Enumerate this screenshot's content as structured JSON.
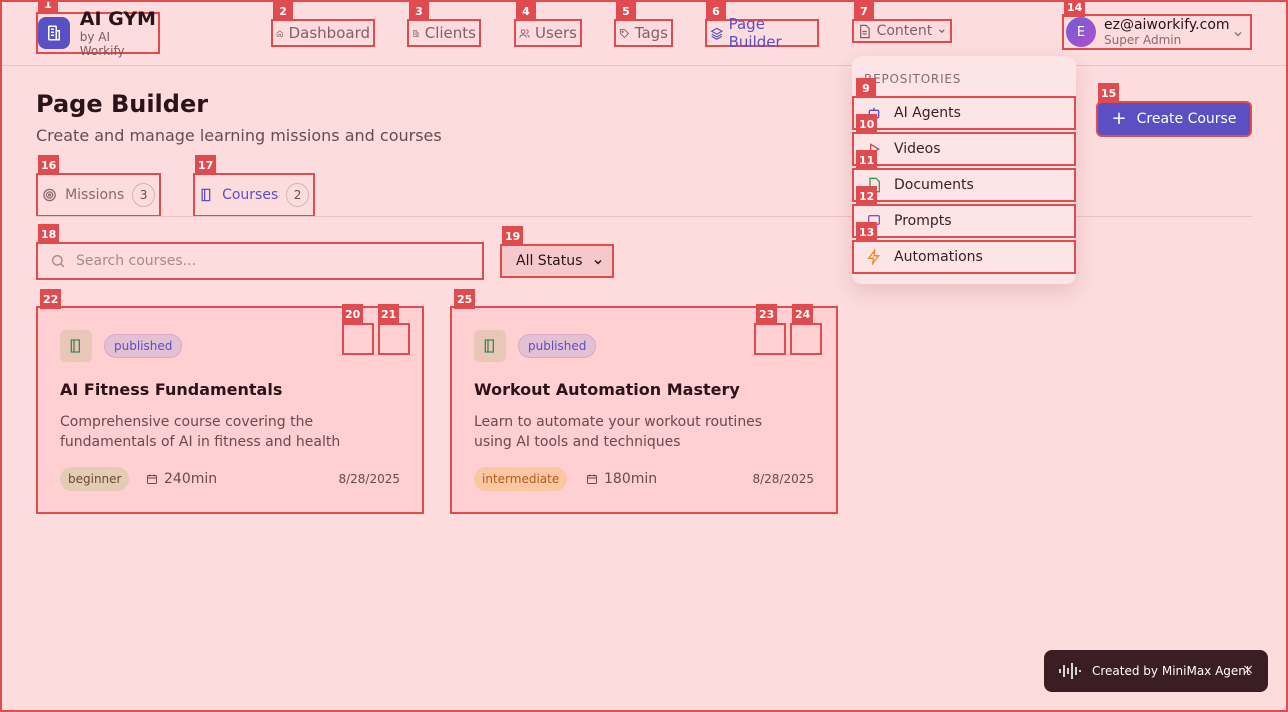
{
  "brand": {
    "title": "AI GYM",
    "subtitle": "by AI Workify"
  },
  "nav": [
    {
      "label": "Dashboard",
      "icon": "home-icon"
    },
    {
      "label": "Clients",
      "icon": "building-icon"
    },
    {
      "label": "Users",
      "icon": "users-icon"
    },
    {
      "label": "Tags",
      "icon": "tag-icon"
    },
    {
      "label": "Page Builder",
      "icon": "layers-icon",
      "active": true
    },
    {
      "label": "Content",
      "icon": "document-icon"
    }
  ],
  "user": {
    "initial": "E",
    "email": "ez@aiworkify.com",
    "role": "Super Admin"
  },
  "content_menu": {
    "heading": "REPOSITORIES",
    "items": [
      {
        "label": "AI Agents",
        "icon": "bot-icon"
      },
      {
        "label": "Videos",
        "icon": "play-icon"
      },
      {
        "label": "Documents",
        "icon": "file-icon"
      },
      {
        "label": "Prompts",
        "icon": "message-icon"
      },
      {
        "label": "Automations",
        "icon": "lightning-icon"
      }
    ]
  },
  "page": {
    "title": "Page Builder",
    "subtitle": "Create and manage learning missions and courses",
    "create_label": "Create Course"
  },
  "tabs": [
    {
      "label": "Missions",
      "count": "3"
    },
    {
      "label": "Courses",
      "count": "2",
      "active": true
    }
  ],
  "filters": {
    "search_placeholder": "Search courses...",
    "status": "All Status"
  },
  "courses": [
    {
      "status": "published",
      "title": "AI Fitness Fundamentals",
      "description": "Comprehensive course covering the fundamentals of AI in fitness and health",
      "level": "beginner",
      "duration": "240min",
      "date": "8/28/2025"
    },
    {
      "status": "published",
      "title": "Workout Automation Mastery",
      "description": "Learn to automate your workout routines using AI tools and techniques",
      "level": "intermediate",
      "duration": "180min",
      "date": "8/28/2025"
    }
  ],
  "toast": {
    "text": "Created by MiniMax Agent",
    "close": "×"
  },
  "markers": [
    "1",
    "2",
    "3",
    "4",
    "5",
    "6",
    "7",
    "9",
    "10",
    "11",
    "12",
    "13",
    "14",
    "15",
    "16",
    "17",
    "18",
    "19",
    "20",
    "21",
    "22",
    "23",
    "24",
    "25"
  ],
  "colors": {
    "accent": "#5b4fc4",
    "marker": "#e04b4f",
    "background": "#fcdcdd",
    "beginner": "#e3cbb6",
    "intermediate": "#fbc7a3"
  }
}
